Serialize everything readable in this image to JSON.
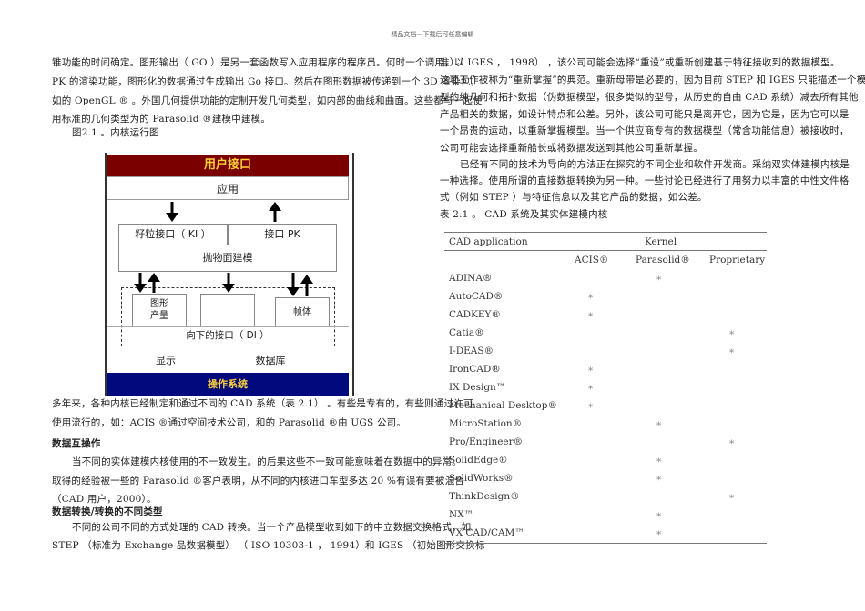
{
  "header": "精品文档---下载后可任意编辑",
  "left_lines": [
    "锥功能的时间确定。图形输出（ GO ）是另一套函数写入应用程序的程序员。何时一个调用，以",
    "PK 的渲染功能，图形化的数据通过生成输出 Go 接口。然后在图形数据被传递到一个 3D 渲染包，",
    "如的 OpenGL ® 。外国几何提供功能的定制开发几何类型，如内部的曲线和曲面。这些都与一起使",
    "用标准的几何类型为的 Parasolid ®建模中建模。"
  ],
  "figure_caption": "图2.1 。内核运行图",
  "diagram": {
    "user_interface": "用户接口",
    "application": "应用",
    "ki": "籽粒接口（ KI ）",
    "pk": "接口 PK",
    "modeler": "抛物面建模",
    "graphics_1": "图形",
    "graphics_2": "产量",
    "frame": "帧体",
    "di": "向下的接口（ DI ）",
    "display": "显示",
    "database": "数据库",
    "os": "操作系统"
  },
  "left_lines2": [
    "多年来，各种内核已经制定和通过不同的 CAD 系统（表 2.1） 。有些是专有的，有些则通过许可",
    "使用流行的，如：ACIS ®通过空间技术公司，和的 Parasolid ®由 UGS 公司。"
  ],
  "heading1": "数据互操作",
  "para1": [
    "当不同的实体建模内核使用的不一致发生。的后果这些不一致可能意味着在数据中的异常。",
    "取得的经验被一些的 Parasolid ®客户表明，从不同的内核进口车型多达 20 %有误有要被混合",
    "（CAD 用户，2000）。"
  ],
  "heading2": "数据转换/转换的不同类型",
  "para2": [
    "不同的公司不同的方式处理的 CAD 转换。当一个产品模型收到如下的中立数据交换格式，如",
    "STEP （标准为 Exchange 品数据模型） （ ISO 10303-1 ， 1994）和 IGES （初始图形交换标"
  ],
  "right_lines": [
    "准）（ IGES ， 1998） ，该公司可能会选择“重设”或重新创建基于特征接收到的数据模型。",
    "这项工作被称为“重新掌握”的典范。重新母带是必要的，因为目前 STEP 和 IGES 只能描述一个模",
    "型的纯几何和拓扑数据（伪数据模型，很多类似的型号，从历史的自由 CAD 系统）减去所有其他",
    "产品相关的数据，如设计特点和公差。另外，该公司可能只是离开它，因为它是，因为它可以是",
    "一个昂贵的运动，以重新掌握模型。当一个供应商专有的数据模型（常含功能信息）被接收时，",
    "公司可能会选择重新船长或将数据发送到其他公司重新掌握。",
    "已经有不同的技术为导向的方法正在探究的不同企业和软件开发商。采纳双实体建模内核是",
    "一种选择。使用所谓的直接数据转换为另一种。一些讨论已经进行了用努力以丰富的中性文件格",
    "式（例如 STEP ）与特征信息以及其它产品的数据，如公差。"
  ],
  "table_caption": "表 2.1 。 CAD 系统及其实体建模内核",
  "table": {
    "col_app": "CAD application",
    "col_kernel": "Kernel",
    "sub": [
      "ACIS®",
      "Parasolid®",
      "Proprietary"
    ],
    "mark": "*",
    "rows": [
      {
        "name": "ADINA®",
        "k": 1
      },
      {
        "name": "AutoCAD®",
        "k": 0
      },
      {
        "name": "CADKEY®",
        "k": 0
      },
      {
        "name": "Catia®",
        "k": 2
      },
      {
        "name": "I-DEAS®",
        "k": 2
      },
      {
        "name": "IronCAD®",
        "k": 0
      },
      {
        "name": "IX Design™",
        "k": 0
      },
      {
        "name": "Mechanical Desktop®",
        "k": 0
      },
      {
        "name": "MicroStation®",
        "k": 1
      },
      {
        "name": "Pro/Engineer®",
        "k": 2
      },
      {
        "name": "SolidEdge®",
        "k": 1
      },
      {
        "name": "SolidWorks®",
        "k": 1
      },
      {
        "name": "ThinkDesign®",
        "k": 2
      },
      {
        "name": "NX™",
        "k": 1
      },
      {
        "name": "VX CAD/CAM™",
        "k": 1
      }
    ]
  }
}
